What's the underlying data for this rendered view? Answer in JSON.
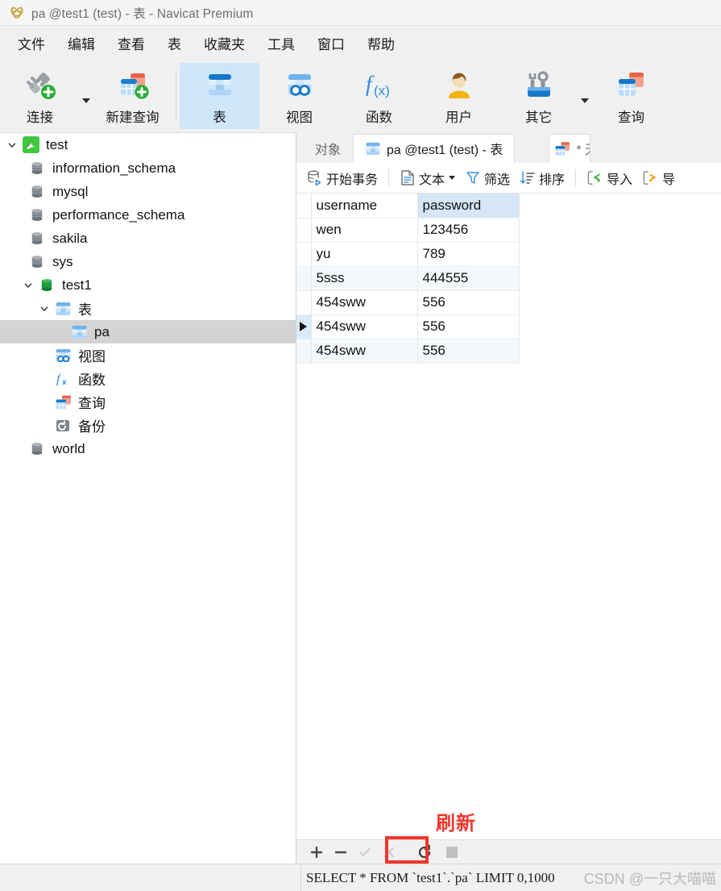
{
  "window": {
    "title": "pa @test1 (test) - 表 - Navicat Premium",
    "logo_icon": "navicat-logo-icon"
  },
  "menubar": {
    "items": [
      {
        "label": "文件",
        "name": "menu-file"
      },
      {
        "label": "编辑",
        "name": "menu-edit"
      },
      {
        "label": "查看",
        "name": "menu-view"
      },
      {
        "label": "表",
        "name": "menu-table"
      },
      {
        "label": "收藏夹",
        "name": "menu-favorites"
      },
      {
        "label": "工具",
        "name": "menu-tools"
      },
      {
        "label": "窗口",
        "name": "menu-window"
      },
      {
        "label": "帮助",
        "name": "menu-help"
      }
    ]
  },
  "ribbon": {
    "items": [
      {
        "label": "连接",
        "icon": "connection-icon",
        "selected": false,
        "caret": true
      },
      {
        "label": "新建查询",
        "icon": "new-query-icon",
        "selected": false,
        "caret": false
      },
      {
        "label": "表",
        "icon": "table-icon",
        "selected": true,
        "caret": false
      },
      {
        "label": "视图",
        "icon": "view-icon",
        "selected": false,
        "caret": false
      },
      {
        "label": "函数",
        "icon": "function-fx-icon",
        "selected": false,
        "caret": false
      },
      {
        "label": "用户",
        "icon": "user-icon",
        "selected": false,
        "caret": false
      },
      {
        "label": "其它",
        "icon": "other-tools-icon",
        "selected": false,
        "caret": true
      },
      {
        "label": "查询",
        "icon": "query-icon",
        "selected": false,
        "caret": false
      }
    ]
  },
  "sidebar": {
    "nodes": [
      {
        "label": "test",
        "icon": "mysql-connection-icon",
        "indent": 0,
        "twisty": "expanded",
        "selected": false
      },
      {
        "label": "information_schema",
        "icon": "database-gray-icon",
        "indent": 1,
        "twisty": "none",
        "selected": false
      },
      {
        "label": "mysql",
        "icon": "database-gray-icon",
        "indent": 1,
        "twisty": "none",
        "selected": false
      },
      {
        "label": "performance_schema",
        "icon": "database-gray-icon",
        "indent": 1,
        "twisty": "none",
        "selected": false
      },
      {
        "label": "sakila",
        "icon": "database-gray-icon",
        "indent": 1,
        "twisty": "none",
        "selected": false
      },
      {
        "label": "sys",
        "icon": "database-gray-icon",
        "indent": 1,
        "twisty": "none",
        "selected": false
      },
      {
        "label": "test1",
        "icon": "database-green-icon",
        "indent": 1,
        "twisty": "expanded",
        "selected": false
      },
      {
        "label": "表",
        "icon": "table-icon",
        "indent": 2,
        "twisty": "expanded",
        "selected": false
      },
      {
        "label": "pa",
        "icon": "table-icon",
        "indent": 3,
        "twisty": "none",
        "selected": true
      },
      {
        "label": "视图",
        "icon": "view-icon",
        "indent": 2,
        "twisty": "none",
        "selected": false
      },
      {
        "label": "函数",
        "icon": "function-fx-icon",
        "indent": 2,
        "twisty": "none",
        "selected": false
      },
      {
        "label": "查询",
        "icon": "query-icon",
        "indent": 2,
        "twisty": "none",
        "selected": false
      },
      {
        "label": "备份",
        "icon": "backup-icon",
        "indent": 2,
        "twisty": "none",
        "selected": false
      },
      {
        "label": "world",
        "icon": "database-gray-icon",
        "indent": 1,
        "twisty": "none",
        "selected": false
      }
    ]
  },
  "tabs": {
    "items": [
      {
        "label": "对象",
        "icon": "none",
        "active": false
      },
      {
        "label": "pa @test1 (test) - 表",
        "icon": "table-icon",
        "active": true
      },
      {
        "label": "* 无",
        "icon": "query-icon",
        "active": false
      }
    ]
  },
  "grid_toolbar": {
    "items": [
      {
        "label": "开始事务",
        "icon": "begin-transaction-icon",
        "caret": false
      },
      {
        "label": "文本",
        "icon": "text-icon",
        "caret": true
      },
      {
        "label": "筛选",
        "icon": "filter-icon",
        "caret": false
      },
      {
        "label": "排序",
        "icon": "sort-icon",
        "caret": false
      },
      {
        "label": "导入",
        "icon": "import-icon",
        "caret": false
      },
      {
        "label": "导",
        "icon": "export-icon",
        "caret": false
      }
    ]
  },
  "table_data": {
    "columns": [
      "username",
      "password"
    ],
    "highlighted_column": "password",
    "current_row_index": 5,
    "rows": [
      [
        "wen",
        "123456"
      ],
      [
        "yu",
        "789"
      ],
      [
        "5sss",
        "444555"
      ],
      [
        "454sww",
        "556"
      ],
      [
        "454sww",
        "556"
      ],
      [
        "454sww",
        "556"
      ]
    ]
  },
  "annotation": {
    "label": "刷新",
    "color": "#f4352c"
  },
  "record_nav": {
    "buttons": [
      {
        "name": "add-record-button",
        "glyph": "+",
        "enabled": true
      },
      {
        "name": "delete-record-button",
        "glyph": "−",
        "enabled": true
      },
      {
        "name": "apply-change-button",
        "glyph": "✓",
        "enabled": false
      },
      {
        "name": "cancel-change-button",
        "glyph": "✕",
        "enabled": false
      },
      {
        "name": "refresh-button",
        "glyph": "↻",
        "enabled": true
      }
    ]
  },
  "statusbar": {
    "sql": "SELECT * FROM `test1`.`pa` LIMIT 0,1000",
    "watermark": "CSDN @一只大喵喵"
  }
}
